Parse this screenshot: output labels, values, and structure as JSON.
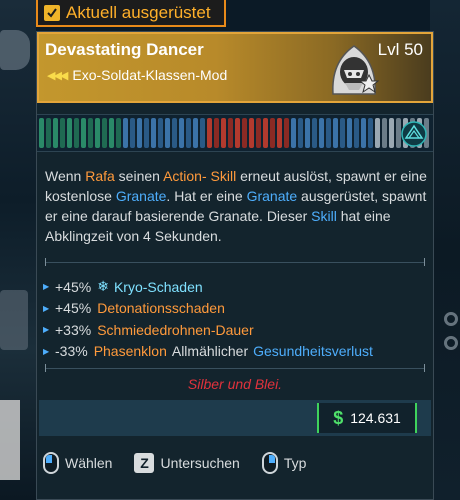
{
  "equipped_tag": "Aktuell ausgerüstet",
  "item": {
    "name": "Devastating Dancer",
    "type": "Exo-Soldat-Klassen-Mod",
    "level": "Lvl 50",
    "rarity_color": "#c3972d"
  },
  "description": {
    "w1": "Wenn ",
    "rafa": "Rafa",
    "w2": " seinen ",
    "action_skill": "Action- Skill",
    "w3": " erneut auslöst, spawnt er eine kostenlose ",
    "granate1": "Granate",
    "w4": ". Hat er eine ",
    "granate2": "Granate",
    "w5": " ausgerüstet, spawnt er eine darauf basierende Granate. Dieser ",
    "skill": "Skill",
    "w6": " hat eine Abklingzeit von 4 Sekunden."
  },
  "stats": [
    {
      "value": "+45%",
      "icon": "snowflake-icon",
      "name": "Kryo-Schaden"
    },
    {
      "value": "+45%",
      "name": "Detonationsschaden"
    },
    {
      "value": "+33%",
      "name": "Schmiededrohnen-Dauer"
    },
    {
      "value": "-33%",
      "name": "Phasenklon",
      "mid": "Allmählicher",
      "tail": "Gesundheitsverlust"
    }
  ],
  "flavor_text": "Silber und Blei.",
  "price": {
    "currency_icon": "dollar-icon",
    "amount": "124.631"
  },
  "actions": [
    {
      "icon": "mouse-left-icon",
      "label": "Wählen"
    },
    {
      "icon": "key-z-icon",
      "key": "Z",
      "label": "Untersuchen"
    },
    {
      "icon": "mouse-right-icon",
      "label": "Typ"
    }
  ],
  "colors": {
    "orange_highlight": "#ff9a3c",
    "blue_highlight": "#4eaefc",
    "cryo": "#7fe1ff",
    "flavor": "#e0323c",
    "money": "#4fe06a",
    "equipped": "#ffb02a"
  }
}
